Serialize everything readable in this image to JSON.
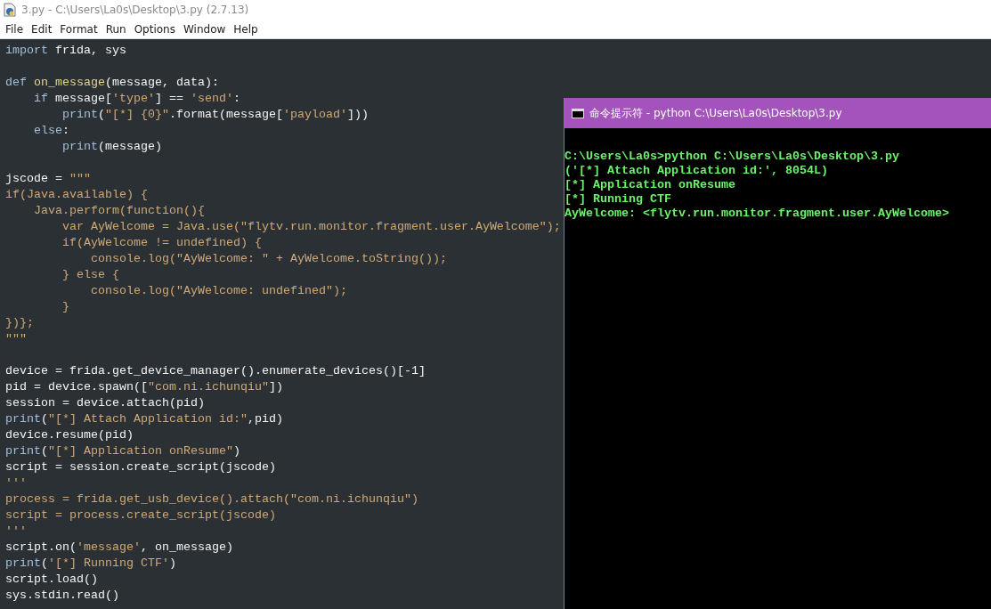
{
  "window": {
    "title": "3.py - C:\\Users\\La0s\\Desktop\\3.py (2.7.13)"
  },
  "menu": [
    "File",
    "Edit",
    "Format",
    "Run",
    "Options",
    "Window",
    "Help"
  ],
  "editor": {
    "lines": [
      {
        "kind": "code",
        "tokens": [
          {
            "kind": "keyword",
            "text": "import"
          },
          {
            "kind": "plain",
            "text": " frida, sys"
          }
        ]
      },
      {
        "kind": "blank"
      },
      {
        "kind": "code",
        "tokens": [
          {
            "kind": "keyword",
            "text": "def "
          },
          {
            "kind": "defname",
            "text": "on_message"
          },
          {
            "kind": "plain",
            "text": "(message, data):"
          }
        ]
      },
      {
        "kind": "code",
        "tokens": [
          {
            "kind": "keyword",
            "text": "    if"
          },
          {
            "kind": "plain",
            "text": " message["
          },
          {
            "kind": "string",
            "text": "'type'"
          },
          {
            "kind": "plain",
            "text": "] == "
          },
          {
            "kind": "string",
            "text": "'send'"
          },
          {
            "kind": "plain",
            "text": ":"
          }
        ]
      },
      {
        "kind": "code",
        "tokens": [
          {
            "kind": "keyword",
            "text": "        print"
          },
          {
            "kind": "plain",
            "text": "("
          },
          {
            "kind": "string",
            "text": "\"[*] {0}\""
          },
          {
            "kind": "plain",
            "text": ".format(message["
          },
          {
            "kind": "string",
            "text": "'payload'"
          },
          {
            "kind": "plain",
            "text": "]))"
          }
        ]
      },
      {
        "kind": "code",
        "tokens": [
          {
            "kind": "keyword",
            "text": "    else"
          },
          {
            "kind": "plain",
            "text": ":"
          }
        ]
      },
      {
        "kind": "code",
        "tokens": [
          {
            "kind": "keyword",
            "text": "        print"
          },
          {
            "kind": "plain",
            "text": "(message)"
          }
        ]
      },
      {
        "kind": "blank"
      },
      {
        "kind": "code",
        "tokens": [
          {
            "kind": "plain",
            "text": "jscode = "
          },
          {
            "kind": "string",
            "text": "\"\"\""
          }
        ]
      },
      {
        "kind": "code",
        "tokens": [
          {
            "kind": "string",
            "text": "if(Java.available) {"
          }
        ]
      },
      {
        "kind": "code",
        "tokens": [
          {
            "kind": "string",
            "text": "    Java.perform(function(){"
          }
        ]
      },
      {
        "kind": "code",
        "tokens": [
          {
            "kind": "string",
            "text": "        var AyWelcome = Java.use(\"flytv.run.monitor.fragment.user.AyWelcome\");"
          }
        ]
      },
      {
        "kind": "code",
        "tokens": [
          {
            "kind": "string",
            "text": "        if(AyWelcome != undefined) {"
          }
        ]
      },
      {
        "kind": "code",
        "tokens": [
          {
            "kind": "string",
            "text": "            console.log(\"AyWelcome: \" + AyWelcome.toString());"
          }
        ]
      },
      {
        "kind": "code",
        "tokens": [
          {
            "kind": "string",
            "text": "        } else {"
          }
        ]
      },
      {
        "kind": "code",
        "tokens": [
          {
            "kind": "string",
            "text": "            console.log(\"AyWelcome: undefined\");"
          }
        ]
      },
      {
        "kind": "code",
        "tokens": [
          {
            "kind": "string",
            "text": "        }"
          }
        ]
      },
      {
        "kind": "code",
        "tokens": [
          {
            "kind": "string",
            "text": "})};"
          }
        ]
      },
      {
        "kind": "code",
        "tokens": [
          {
            "kind": "string",
            "text": "\"\"\""
          }
        ]
      },
      {
        "kind": "blank"
      },
      {
        "kind": "code",
        "tokens": [
          {
            "kind": "plain",
            "text": "device = frida.get_device_manager().enumerate_devices()[-1]"
          }
        ]
      },
      {
        "kind": "code",
        "tokens": [
          {
            "kind": "plain",
            "text": "pid = device.spawn(["
          },
          {
            "kind": "string",
            "text": "\"com.ni.ichunqiu\""
          },
          {
            "kind": "plain",
            "text": "])"
          }
        ]
      },
      {
        "kind": "code",
        "tokens": [
          {
            "kind": "plain",
            "text": "session = device.attach(pid)"
          }
        ]
      },
      {
        "kind": "code",
        "tokens": [
          {
            "kind": "keyword",
            "text": "print"
          },
          {
            "kind": "plain",
            "text": "("
          },
          {
            "kind": "string",
            "text": "\"[*] Attach Application id:\""
          },
          {
            "kind": "plain",
            "text": ",pid)"
          }
        ]
      },
      {
        "kind": "code",
        "tokens": [
          {
            "kind": "plain",
            "text": "device.resume(pid)"
          }
        ]
      },
      {
        "kind": "code",
        "tokens": [
          {
            "kind": "keyword",
            "text": "print"
          },
          {
            "kind": "plain",
            "text": "("
          },
          {
            "kind": "string",
            "text": "\"[*] Application onResume\""
          },
          {
            "kind": "plain",
            "text": ")"
          }
        ]
      },
      {
        "kind": "code",
        "tokens": [
          {
            "kind": "plain",
            "text": "script = session.create_script(jscode)"
          }
        ]
      },
      {
        "kind": "code",
        "tokens": [
          {
            "kind": "string",
            "text": "'''"
          }
        ]
      },
      {
        "kind": "code",
        "tokens": [
          {
            "kind": "string",
            "text": "process = frida.get_usb_device().attach(\"com.ni.ichunqiu\")"
          }
        ]
      },
      {
        "kind": "code",
        "tokens": [
          {
            "kind": "string",
            "text": "script = process.create_script(jscode)"
          }
        ]
      },
      {
        "kind": "code",
        "tokens": [
          {
            "kind": "string",
            "text": "'''"
          }
        ]
      },
      {
        "kind": "code",
        "tokens": [
          {
            "kind": "plain",
            "text": "script.on("
          },
          {
            "kind": "string",
            "text": "'message'"
          },
          {
            "kind": "plain",
            "text": ", on_message)"
          }
        ]
      },
      {
        "kind": "code",
        "tokens": [
          {
            "kind": "keyword",
            "text": "print"
          },
          {
            "kind": "plain",
            "text": "("
          },
          {
            "kind": "string",
            "text": "'[*] Running CTF'"
          },
          {
            "kind": "plain",
            "text": ")"
          }
        ]
      },
      {
        "kind": "code",
        "tokens": [
          {
            "kind": "plain",
            "text": "script.load()"
          }
        ]
      },
      {
        "kind": "code",
        "tokens": [
          {
            "kind": "plain",
            "text": "sys.stdin.read()"
          }
        ]
      }
    ]
  },
  "console": {
    "title": "命令提示符 - python  C:\\Users\\La0s\\Desktop\\3.py",
    "lines": [
      "C:\\Users\\La0s>python C:\\Users\\La0s\\Desktop\\3.py",
      "('[*] Attach Application id:', 8054L)",
      "[*] Application onResume",
      "[*] Running CTF",
      "AyWelcome: <flytv.run.monitor.fragment.user.AyWelcome>"
    ]
  }
}
